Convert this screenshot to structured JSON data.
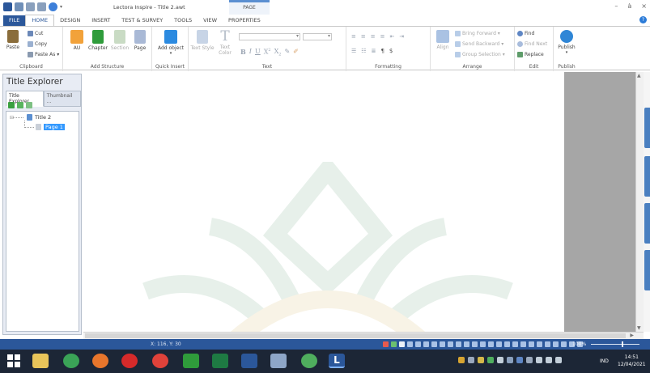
{
  "window": {
    "title": "Lectora Inspire - Title 2.awt",
    "context_group": "PAGE",
    "controls": {
      "minimize": "–",
      "restore": "ȧ",
      "close": "×"
    }
  },
  "ribbon_tabs": [
    {
      "label": "FILE"
    },
    {
      "label": "HOME"
    },
    {
      "label": "DESIGN"
    },
    {
      "label": "INSERT"
    },
    {
      "label": "TEST & SURVEY"
    },
    {
      "label": "TOOLS"
    },
    {
      "label": "VIEW"
    },
    {
      "label": "PROPERTIES"
    }
  ],
  "ribbon": {
    "clipboard": {
      "label": "Clipboard",
      "paste": "Paste",
      "cut": "Cut",
      "copy": "Copy",
      "paste_as": "Paste As ▾"
    },
    "add_structure": {
      "label": "Add Structure",
      "au": "AU",
      "chapter": "Chapter",
      "section": "Section",
      "page": "Page"
    },
    "quick_insert": {
      "label": "Quick Insert",
      "add_object": "Add object"
    },
    "text": {
      "label": "Text",
      "text_style": "Text Style",
      "text_color": "Text Color"
    },
    "formatting": {
      "label": "Formatting"
    },
    "arrange": {
      "label": "Arrange",
      "align": "Align",
      "bring_forward": "Bring Forward ▾",
      "send_backward": "Send Backward ▾",
      "group_selection": "Group Selection ▾"
    },
    "edit": {
      "label": "Edit",
      "find": "Find",
      "find_next": "Find Next",
      "replace": "Replace"
    },
    "publish": {
      "label": "Publish",
      "publish": "Publish"
    }
  },
  "title_explorer": {
    "heading": "Title Explorer",
    "tabs": [
      {
        "label": "Title Explorer"
      },
      {
        "label": "Thumbnail ..."
      }
    ],
    "tree": {
      "root": "Title 2",
      "child": "Page 1"
    }
  },
  "statusbar": {
    "coords": "X: 116, Y: 30",
    "zoom": "100%"
  },
  "taskbar": {
    "language": "IND",
    "time": "14:51",
    "date": "12/04/2021"
  },
  "colors": {
    "accent": "#2b579a",
    "taskbar": "#1c2636",
    "selection": "#3399ff",
    "watermark": "#3f8a5a",
    "watermark_gold": "#c9a23a"
  }
}
